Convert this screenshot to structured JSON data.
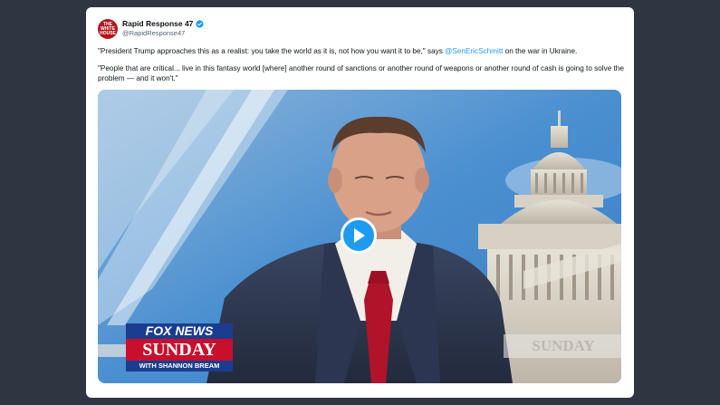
{
  "tweet": {
    "display_name": "Rapid Response 47",
    "handle": "@RapidResponse47",
    "avatar_text": "THE WHITE HOUSE",
    "para1_before": "\"President Trump approaches this as a realist: you take the world as it is, not how you want it to be,\" says ",
    "para1_mention": "@SenEricSchmitt",
    "para1_after": " on the war in Ukraine.",
    "para2": "\"People that are critical... live in this fantasy world [where] another round of sanctions or another round of weapons or another round of cash is going to solve the problem — and it won't.\""
  },
  "video": {
    "logo_top": "FOX NEWS",
    "logo_main": "SUNDAY",
    "logo_sub": "WITH SHANNON BREAM",
    "bg_watermark": "SUNDAY"
  },
  "colors": {
    "accent": "#1d9bf0",
    "background": "#2f3541",
    "card": "#ffffff",
    "fox_red": "#c8102e",
    "fox_blue": "#1b3d8f"
  }
}
